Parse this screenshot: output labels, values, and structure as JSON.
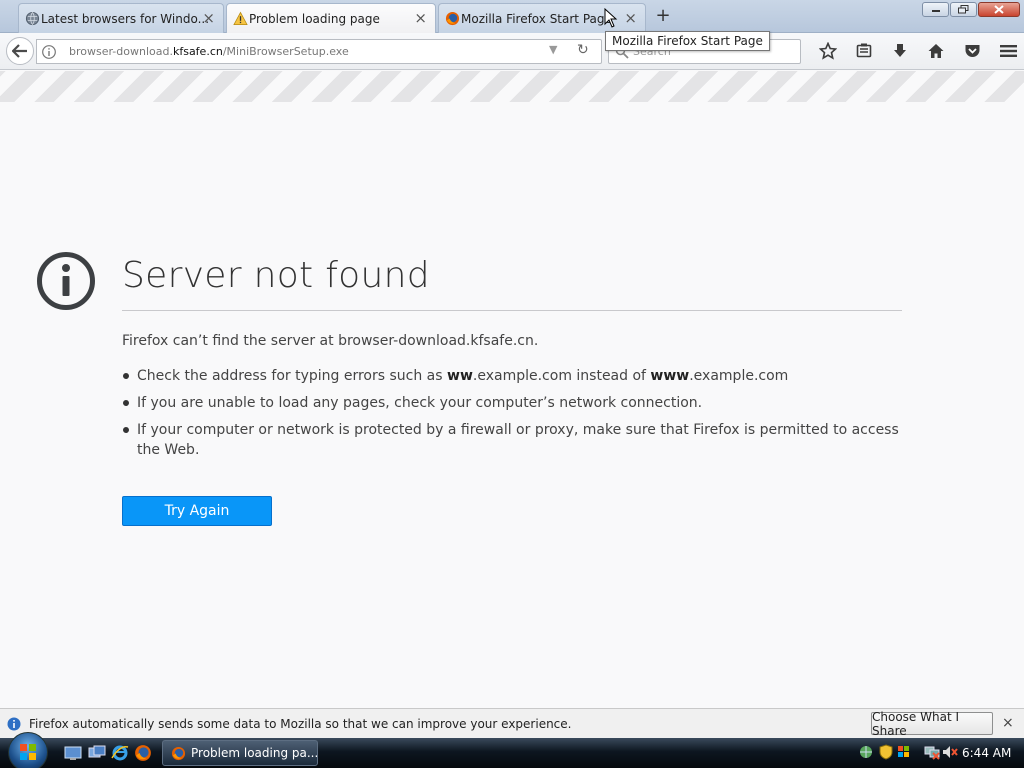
{
  "window": {
    "tabs": [
      {
        "label": "Latest browsers for Windo...",
        "state": "inactive",
        "icon": "globe-icon"
      },
      {
        "label": "Problem loading page",
        "state": "active",
        "icon": "warning-icon"
      },
      {
        "label": "Mozilla Firefox Start Page",
        "state": "inactive",
        "icon": "firefox-icon"
      }
    ],
    "new_tab_label": "+",
    "tab_close_glyph": "×",
    "controls": {
      "minimize": "minimize-icon",
      "restore": "restore-icon",
      "close": "close-icon"
    }
  },
  "navbar": {
    "url_prefix": "browser-download.",
    "url_domain": "kfsafe.cn",
    "url_suffix": "/MiniBrowserSetup.exe",
    "search_placeholder": "Search",
    "toolbar_icons": [
      "bookmark-star-icon",
      "reading-list-icon",
      "download-icon",
      "home-icon",
      "pocket-icon",
      "menu-icon"
    ]
  },
  "tooltip": "Mozilla Firefox Start Page",
  "error": {
    "title": "Server not found",
    "description": "Firefox can’t find the server at browser-download.kfsafe.cn.",
    "bullet1_pre": "Check the address for typing errors such as ",
    "bullet1_b1": "ww",
    "bullet1_mid": ".example.com instead of ",
    "bullet1_b2": "www",
    "bullet1_post": ".example.com",
    "bullet2": "If you are unable to load any pages, check your computer’s network connection.",
    "bullet3": "If your computer or network is protected by a firewall or proxy, make sure that Firefox is permitted to access the Web.",
    "try_again": "Try Again"
  },
  "notification": {
    "text": "Firefox automatically sends some data to Mozilla so that we can improve your experience.",
    "button": "Choose What I Share",
    "close": "×"
  },
  "taskbar": {
    "task_label": "Problem loading pa...",
    "time": "6:44 AM"
  },
  "colors": {
    "accent": "#0996f8",
    "tab_strip": "#c4d2e3",
    "taskbar": "#0d1620"
  }
}
